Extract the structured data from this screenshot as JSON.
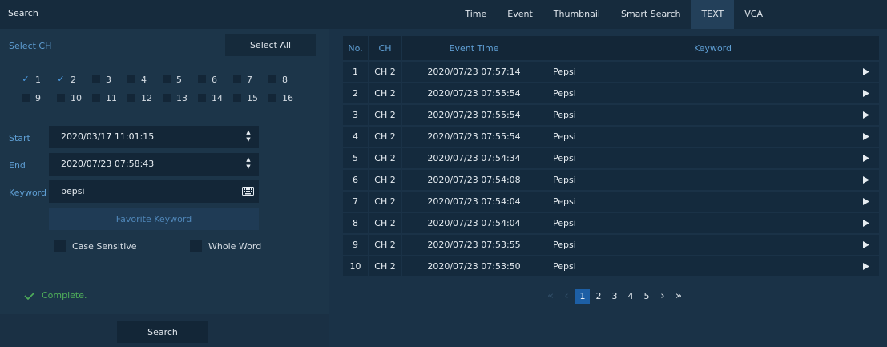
{
  "app": {
    "title": "Search"
  },
  "tabs": [
    {
      "label": "Time",
      "active": false
    },
    {
      "label": "Event",
      "active": false
    },
    {
      "label": "Thumbnail",
      "active": false
    },
    {
      "label": "Smart Search",
      "active": false
    },
    {
      "label": "TEXT",
      "active": true
    },
    {
      "label": "VCA",
      "active": false
    }
  ],
  "channels": {
    "label": "Select CH",
    "select_all_label": "Select All",
    "items": [
      {
        "label": "1",
        "checked": true
      },
      {
        "label": "2",
        "checked": true
      },
      {
        "label": "3",
        "checked": false
      },
      {
        "label": "4",
        "checked": false
      },
      {
        "label": "5",
        "checked": false
      },
      {
        "label": "6",
        "checked": false
      },
      {
        "label": "7",
        "checked": false
      },
      {
        "label": "8",
        "checked": false
      },
      {
        "label": "9",
        "checked": false
      },
      {
        "label": "10",
        "checked": false
      },
      {
        "label": "11",
        "checked": false
      },
      {
        "label": "12",
        "checked": false
      },
      {
        "label": "13",
        "checked": false
      },
      {
        "label": "14",
        "checked": false
      },
      {
        "label": "15",
        "checked": false
      },
      {
        "label": "16",
        "checked": false
      }
    ]
  },
  "form": {
    "start_label": "Start",
    "start_value": "2020/03/17 11:01:15",
    "end_label": "End",
    "end_value": "2020/07/23 07:58:43",
    "keyword_label": "Keyword",
    "keyword_value": "pepsi",
    "favorite_keyword_label": "Favorite Keyword",
    "case_sensitive_label": "Case Sensitive",
    "case_sensitive_checked": false,
    "whole_word_label": "Whole Word",
    "whole_word_checked": false,
    "keyboard_icon": "keyboard-icon",
    "spinner_icon": "spinner-arrows-icon"
  },
  "status": {
    "text": "Complete.",
    "icon": "check-icon",
    "color": "#4fae5a"
  },
  "search_button_label": "Search",
  "table": {
    "headers": {
      "no": "No.",
      "ch": "CH",
      "event_time": "Event Time",
      "keyword": "Keyword"
    },
    "rows": [
      {
        "no": "1",
        "ch": "CH 2",
        "time": "2020/07/23 07:57:14",
        "keyword": "Pepsi"
      },
      {
        "no": "2",
        "ch": "CH 2",
        "time": "2020/07/23 07:55:54",
        "keyword": "Pepsi"
      },
      {
        "no": "3",
        "ch": "CH 2",
        "time": "2020/07/23 07:55:54",
        "keyword": "Pepsi"
      },
      {
        "no": "4",
        "ch": "CH 2",
        "time": "2020/07/23 07:55:54",
        "keyword": "Pepsi"
      },
      {
        "no": "5",
        "ch": "CH 2",
        "time": "2020/07/23 07:54:34",
        "keyword": "Pepsi"
      },
      {
        "no": "6",
        "ch": "CH 2",
        "time": "2020/07/23 07:54:08",
        "keyword": "Pepsi"
      },
      {
        "no": "7",
        "ch": "CH 2",
        "time": "2020/07/23 07:54:04",
        "keyword": "Pepsi"
      },
      {
        "no": "8",
        "ch": "CH 2",
        "time": "2020/07/23 07:54:04",
        "keyword": "Pepsi"
      },
      {
        "no": "9",
        "ch": "CH 2",
        "time": "2020/07/23 07:53:55",
        "keyword": "Pepsi"
      },
      {
        "no": "10",
        "ch": "CH 2",
        "time": "2020/07/23 07:53:50",
        "keyword": "Pepsi"
      }
    ],
    "row_icon": "play-icon"
  },
  "pagination": {
    "pages": [
      "1",
      "2",
      "3",
      "4",
      "5"
    ],
    "current": "1",
    "first_icon": "first-page-icon",
    "prev_icon": "prev-page-icon",
    "next_icon": "next-page-icon",
    "last_icon": "last-page-icon"
  },
  "colors": {
    "background": "#1a3247",
    "accent": "#1d5fa5",
    "label_blue": "#5f9fd4"
  }
}
